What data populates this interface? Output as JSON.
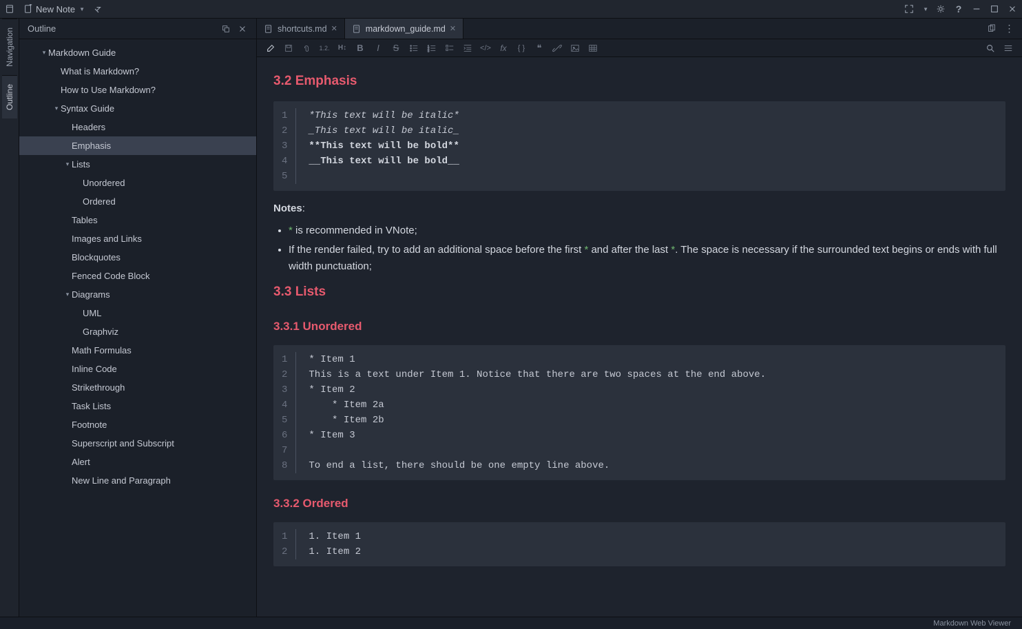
{
  "topbar": {
    "new_note_label": "New Note"
  },
  "vert_tabs": {
    "outline": "Outline",
    "navigation": "Navigation"
  },
  "sidebar": {
    "title": "Outline",
    "items": [
      {
        "label": "Markdown Guide",
        "depth": 0,
        "arrow": "down",
        "selected": false
      },
      {
        "label": "What is Markdown?",
        "depth": 1,
        "arrow": "",
        "selected": false
      },
      {
        "label": "How to Use Markdown?",
        "depth": 1,
        "arrow": "",
        "selected": false
      },
      {
        "label": "Syntax Guide",
        "depth": 1,
        "arrow": "down",
        "selected": false
      },
      {
        "label": "Headers",
        "depth": 2,
        "arrow": "",
        "selected": false
      },
      {
        "label": "Emphasis",
        "depth": 2,
        "arrow": "",
        "selected": true
      },
      {
        "label": "Lists",
        "depth": 2,
        "arrow": "down",
        "selected": false
      },
      {
        "label": "Unordered",
        "depth": 3,
        "arrow": "",
        "selected": false
      },
      {
        "label": "Ordered",
        "depth": 3,
        "arrow": "",
        "selected": false
      },
      {
        "label": "Tables",
        "depth": 2,
        "arrow": "",
        "selected": false
      },
      {
        "label": "Images and Links",
        "depth": 2,
        "arrow": "",
        "selected": false
      },
      {
        "label": "Blockquotes",
        "depth": 2,
        "arrow": "",
        "selected": false
      },
      {
        "label": "Fenced Code Block",
        "depth": 2,
        "arrow": "",
        "selected": false
      },
      {
        "label": "Diagrams",
        "depth": 2,
        "arrow": "down",
        "selected": false
      },
      {
        "label": "UML",
        "depth": 3,
        "arrow": "",
        "selected": false
      },
      {
        "label": "Graphviz",
        "depth": 3,
        "arrow": "",
        "selected": false
      },
      {
        "label": "Math Formulas",
        "depth": 2,
        "arrow": "",
        "selected": false
      },
      {
        "label": "Inline Code",
        "depth": 2,
        "arrow": "",
        "selected": false
      },
      {
        "label": "Strikethrough",
        "depth": 2,
        "arrow": "",
        "selected": false
      },
      {
        "label": "Task Lists",
        "depth": 2,
        "arrow": "",
        "selected": false
      },
      {
        "label": "Footnote",
        "depth": 2,
        "arrow": "",
        "selected": false
      },
      {
        "label": "Superscript and Subscript",
        "depth": 2,
        "arrow": "",
        "selected": false
      },
      {
        "label": "Alert",
        "depth": 2,
        "arrow": "",
        "selected": false
      },
      {
        "label": "New Line and Paragraph",
        "depth": 2,
        "arrow": "",
        "selected": false
      }
    ]
  },
  "tabs": [
    {
      "label": "shortcuts.md",
      "active": false
    },
    {
      "label": "markdown_guide.md",
      "active": true
    }
  ],
  "content": {
    "h_emphasis": "3.2 Emphasis",
    "code_emphasis": {
      "lines": [
        "1",
        "2",
        "3",
        "4",
        "5"
      ],
      "l1": "*This text will be italic*",
      "l2": "_This text will be italic_",
      "l3": "",
      "l4": "**This text will be bold**",
      "l5": "__This text will be bold__"
    },
    "notes_label": "Notes",
    "note1_a": " is recommended in VNote;",
    "note2_a": "If the render failed, try to add an additional space before the first ",
    "note2_b": " and after the last ",
    "note2_c": ". The space is necessary if the surrounded text begins or ends with full width punctuation;",
    "star": "*",
    "h_lists": "3.3 Lists",
    "h_unord": "3.3.1 Unordered",
    "code_unord": {
      "lines": [
        "1",
        "2",
        "3",
        "4",
        "5",
        "6",
        "7",
        "8"
      ],
      "l1": "* Item 1",
      "l2": "This is a text under Item 1. Notice that there are two spaces at the end above.",
      "l3": "* Item 2",
      "l4": "    * Item 2a",
      "l5": "    * Item 2b",
      "l6": "* Item 3",
      "l7": "",
      "l8": "To end a list, there should be one empty line above."
    },
    "h_ord": "3.3.2 Ordered",
    "code_ord": {
      "lines": [
        "1",
        "2"
      ],
      "l1": "1. Item 1",
      "l2": "1. Item 2"
    }
  },
  "statusbar": {
    "mode": "Markdown Web Viewer"
  },
  "toolbar_labels": {
    "bold": "B",
    "italic": "I",
    "strike": "S",
    "h12": "1.2.",
    "h_label": "H",
    "code_angle": "</>",
    "fx": "fx",
    "braces": "{ }",
    "quote": "❝"
  }
}
